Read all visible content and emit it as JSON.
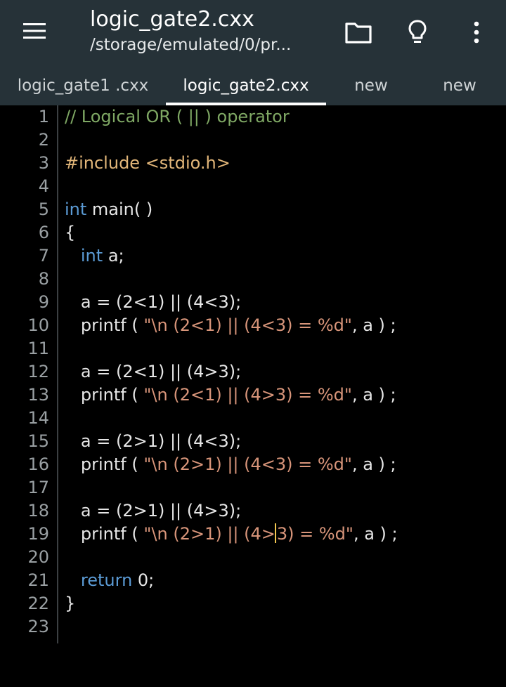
{
  "appbar": {
    "title": "logic_gate2.cxx",
    "subtitle": "/storage/emulated/0/pr...",
    "icons": [
      "menu-icon",
      "folder-icon",
      "lightbulb-icon",
      "more-vert-icon"
    ]
  },
  "tabs": [
    {
      "label": "logic_gate1 .cxx",
      "active": false
    },
    {
      "label": "logic_gate2.cxx",
      "active": true
    },
    {
      "label": "new",
      "active": false
    },
    {
      "label": "new",
      "active": false
    }
  ],
  "colors": {
    "bar": "#263238",
    "editor_bg": "#000000",
    "comment": "#7fa864",
    "preprocessor": "#e2b679",
    "keyword": "#5b9bd5",
    "string": "#d8957a",
    "cursor": "#f2c74f"
  },
  "editor": {
    "cursor": {
      "line": 19,
      "column": 25
    },
    "lines": [
      {
        "n": "1",
        "indent": "",
        "tokens": [
          {
            "t": "// Logical OR ( || ) operator",
            "k": "comment"
          }
        ]
      },
      {
        "n": "2",
        "indent": "",
        "tokens": []
      },
      {
        "n": "3",
        "indent": "",
        "tokens": [
          {
            "t": "#include <stdio.h>",
            "k": "pre"
          }
        ]
      },
      {
        "n": "4",
        "indent": "",
        "tokens": []
      },
      {
        "n": "5",
        "indent": "",
        "tokens": [
          {
            "t": "int",
            "k": "kw"
          },
          {
            "t": " main( )",
            "k": "txt"
          }
        ]
      },
      {
        "n": "6",
        "indent": "",
        "tokens": [
          {
            "t": "{",
            "k": "txt"
          }
        ]
      },
      {
        "n": "7",
        "indent": "   ",
        "tokens": [
          {
            "t": "int",
            "k": "kw"
          },
          {
            "t": " a;",
            "k": "txt"
          }
        ]
      },
      {
        "n": "8",
        "indent": "",
        "tokens": []
      },
      {
        "n": "9",
        "indent": "   ",
        "tokens": [
          {
            "t": "a = (2<1) || (4<3);",
            "k": "txt"
          }
        ]
      },
      {
        "n": "10",
        "indent": "   ",
        "tokens": [
          {
            "t": "printf ( ",
            "k": "txt"
          },
          {
            "t": "\"\\n (2<1) || (4<3) = %d\"",
            "k": "str"
          },
          {
            "t": ", a ) ;",
            "k": "txt"
          }
        ]
      },
      {
        "n": "11",
        "indent": "",
        "tokens": []
      },
      {
        "n": "12",
        "indent": "   ",
        "tokens": [
          {
            "t": "a = (2<1) || (4>3);",
            "k": "txt"
          }
        ]
      },
      {
        "n": "13",
        "indent": "   ",
        "tokens": [
          {
            "t": "printf ( ",
            "k": "txt"
          },
          {
            "t": "\"\\n (2<1) || (4>3) = %d\"",
            "k": "str"
          },
          {
            "t": ", a ) ;",
            "k": "txt"
          }
        ]
      },
      {
        "n": "14",
        "indent": "",
        "tokens": []
      },
      {
        "n": "15",
        "indent": "   ",
        "tokens": [
          {
            "t": "a = (2>1) || (4<3);",
            "k": "txt"
          }
        ]
      },
      {
        "n": "16",
        "indent": "   ",
        "tokens": [
          {
            "t": "printf ( ",
            "k": "txt"
          },
          {
            "t": "\"\\n (2>1) || (4<3) = %d\"",
            "k": "str"
          },
          {
            "t": ", a ) ;",
            "k": "txt"
          }
        ]
      },
      {
        "n": "17",
        "indent": "",
        "tokens": []
      },
      {
        "n": "18",
        "indent": "   ",
        "tokens": [
          {
            "t": "a = (2>1) || (4>3);",
            "k": "txt"
          }
        ]
      },
      {
        "n": "19",
        "indent": "   ",
        "tokens": [
          {
            "t": "printf ( ",
            "k": "txt"
          },
          {
            "t": "\"\\n (2>1) || (4>",
            "k": "str"
          },
          {
            "t": "|",
            "k": "cursor"
          },
          {
            "t": "3) = %d\"",
            "k": "str"
          },
          {
            "t": ", a ) ;",
            "k": "txt"
          }
        ]
      },
      {
        "n": "20",
        "indent": "",
        "tokens": []
      },
      {
        "n": "21",
        "indent": "   ",
        "tokens": [
          {
            "t": "return",
            "k": "kw"
          },
          {
            "t": " 0;",
            "k": "txt"
          }
        ]
      },
      {
        "n": "22",
        "indent": "",
        "tokens": [
          {
            "t": "}",
            "k": "txt"
          }
        ]
      },
      {
        "n": "23",
        "indent": "",
        "tokens": []
      }
    ]
  }
}
